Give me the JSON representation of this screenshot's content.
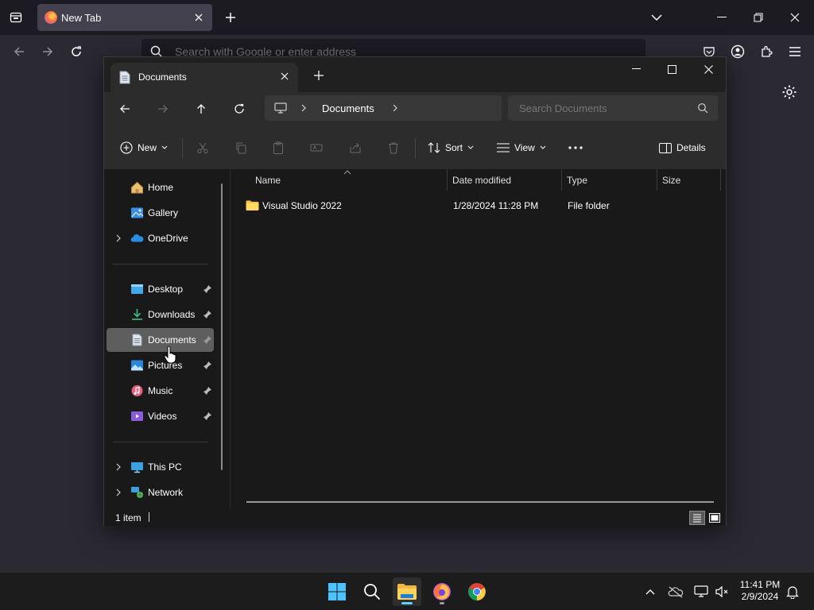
{
  "browser": {
    "tab_title": "New Tab",
    "url_placeholder": "Search with Google or enter address"
  },
  "explorer": {
    "tab_title": "Documents",
    "breadcrumb": [
      "Documents"
    ],
    "search_placeholder": "Search Documents",
    "commands": {
      "new": "New",
      "sort": "Sort",
      "view": "View",
      "details": "Details"
    },
    "sidebar": {
      "quick": [
        {
          "label": "Home",
          "icon": "home-icon"
        },
        {
          "label": "Gallery",
          "icon": "gallery-icon"
        },
        {
          "label": "OneDrive",
          "icon": "onedrive-icon"
        }
      ],
      "pinned": [
        {
          "label": "Desktop",
          "icon": "desktop-icon"
        },
        {
          "label": "Downloads",
          "icon": "downloads-icon"
        },
        {
          "label": "Documents",
          "icon": "documents-icon",
          "selected": true
        },
        {
          "label": "Pictures",
          "icon": "pictures-icon"
        },
        {
          "label": "Music",
          "icon": "music-icon"
        },
        {
          "label": "Videos",
          "icon": "videos-icon"
        }
      ],
      "devices": [
        {
          "label": "This PC",
          "icon": "this-pc-icon"
        },
        {
          "label": "Network",
          "icon": "network-icon"
        }
      ]
    },
    "columns": {
      "name": "Name",
      "date": "Date modified",
      "type": "Type",
      "size": "Size"
    },
    "files": [
      {
        "name": "Visual Studio 2022",
        "date": "1/28/2024 11:28 PM",
        "type": "File folder",
        "size": ""
      }
    ],
    "status": "1 item"
  },
  "taskbar": {
    "time": "11:41 PM",
    "date": "2/9/2024"
  },
  "colors": {
    "accent": "#60cdff",
    "folder": "#f4c542",
    "selection": "#5e5e5e"
  }
}
